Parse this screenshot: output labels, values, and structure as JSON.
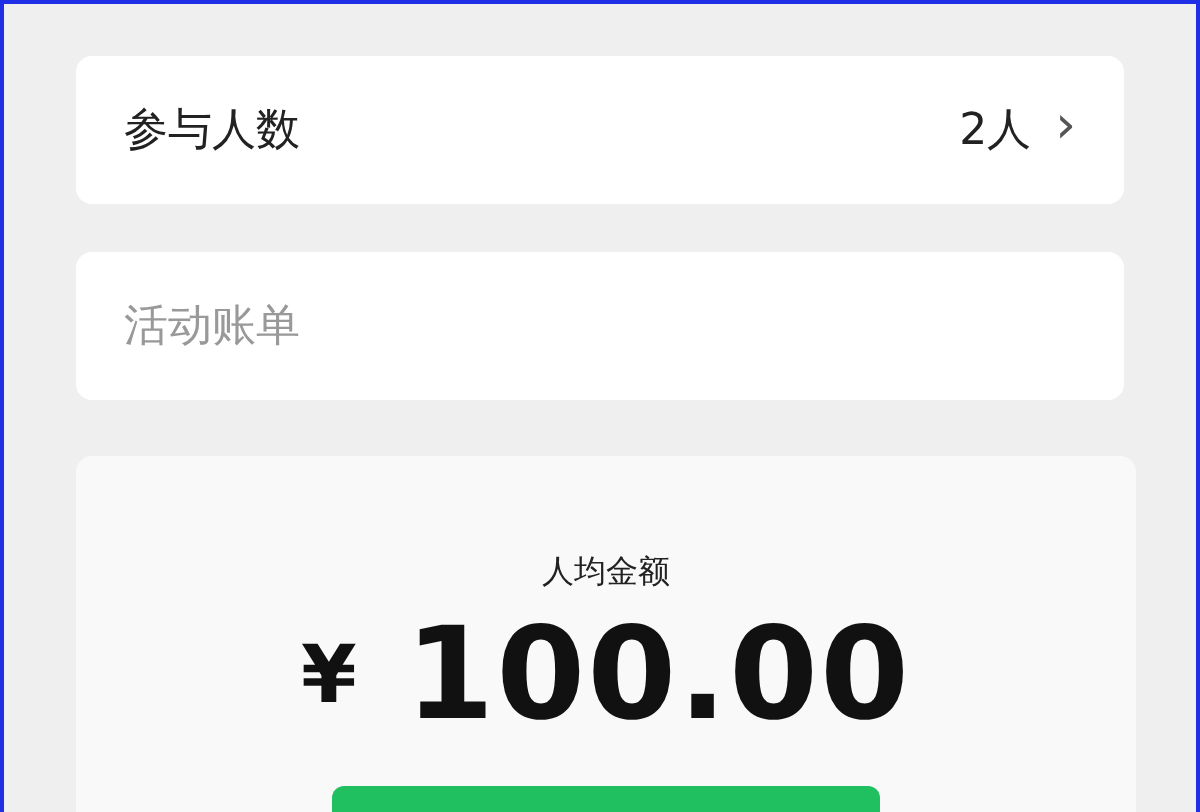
{
  "participants": {
    "label": "参与人数",
    "value": "2人",
    "chevron": "›"
  },
  "bill_field": {
    "placeholder": "活动账单"
  },
  "summary": {
    "label": "人均金额",
    "currency": "¥",
    "amount": "100.00"
  }
}
